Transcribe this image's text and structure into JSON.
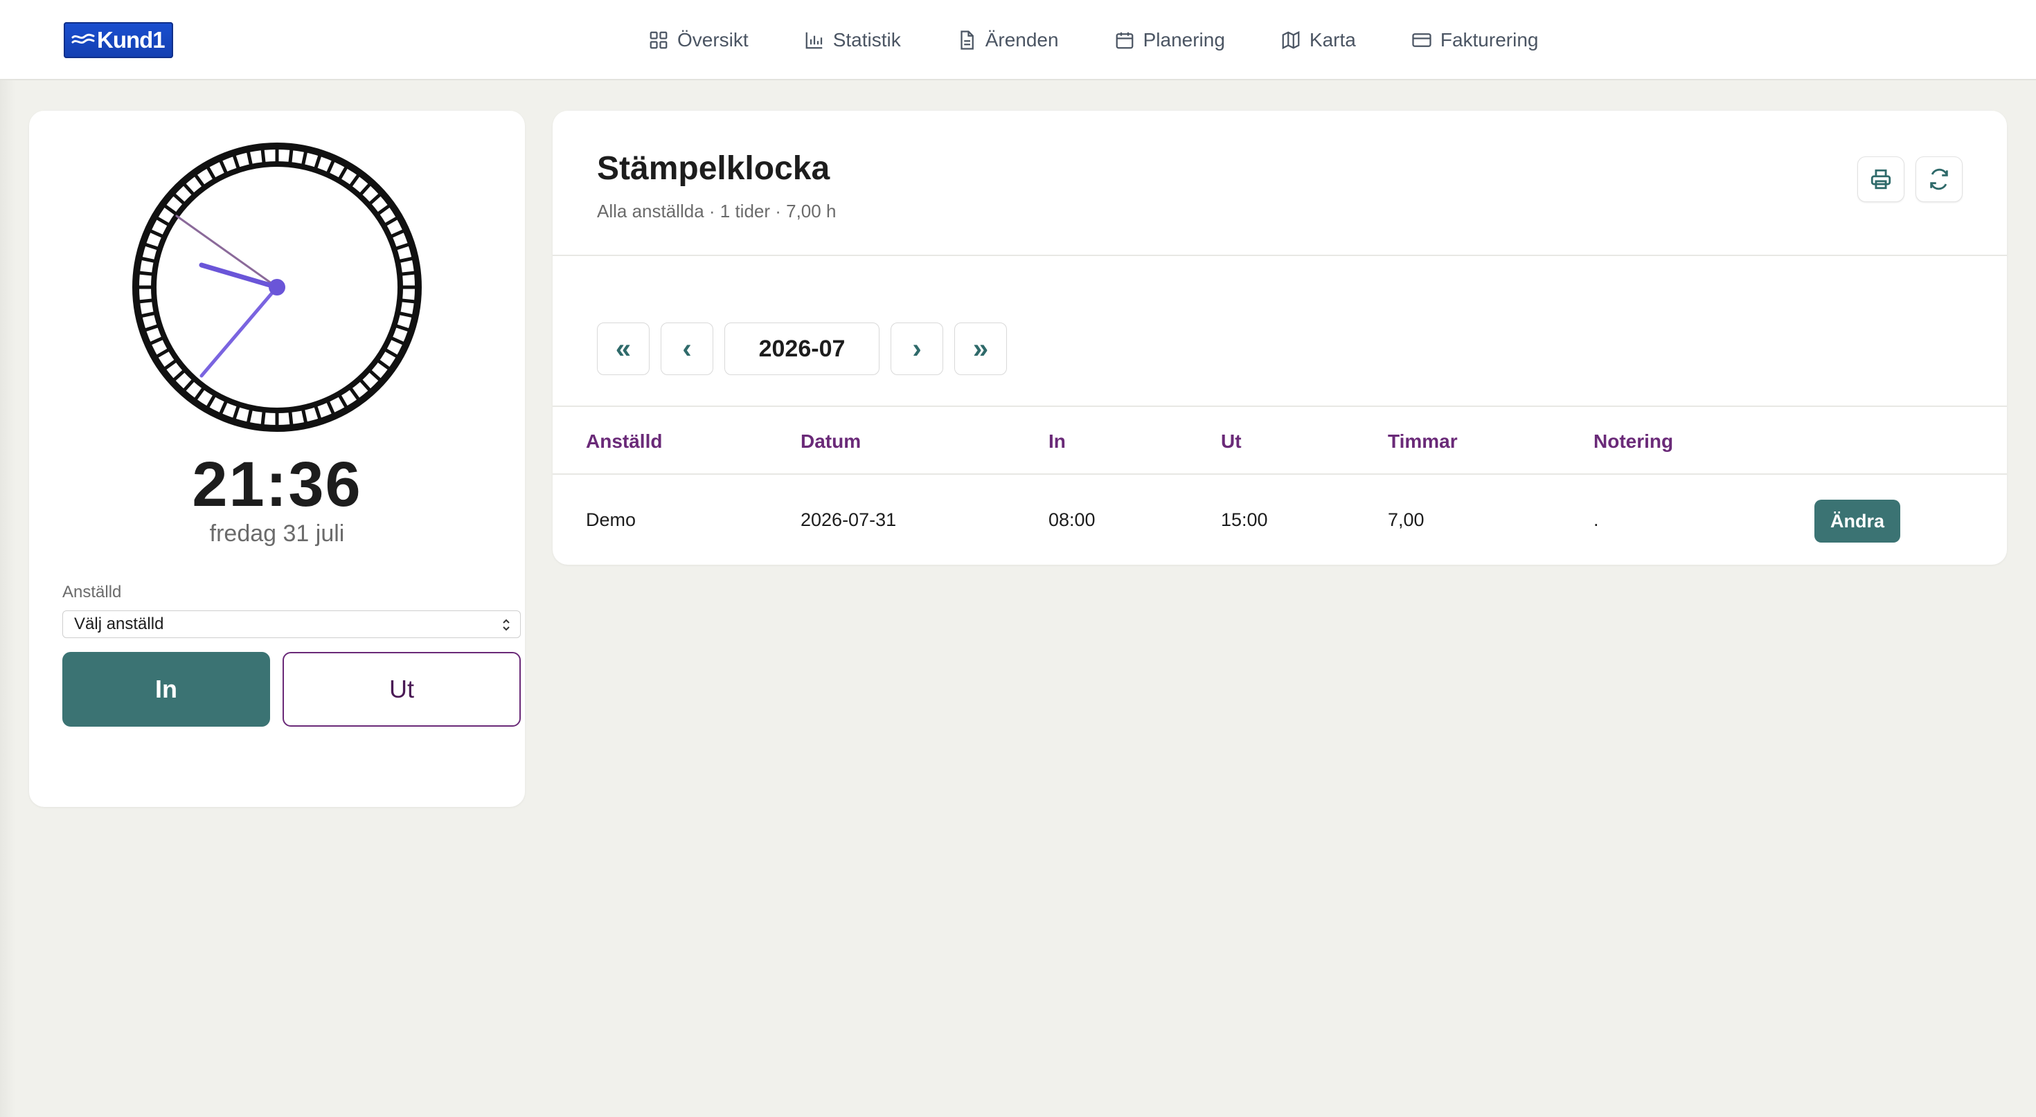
{
  "app": {
    "logo_text": "Kund1",
    "brand_color": "#1a4fd0",
    "accent_color": "#3b7373",
    "header_color": "#6a2a78"
  },
  "nav": {
    "items": [
      {
        "label": "Översikt",
        "icon": "grid-icon"
      },
      {
        "label": "Statistik",
        "icon": "bar-chart-icon"
      },
      {
        "label": "Ärenden",
        "icon": "document-icon"
      },
      {
        "label": "Planering",
        "icon": "calendar-icon"
      },
      {
        "label": "Karta",
        "icon": "map-icon"
      },
      {
        "label": "Fakturering",
        "icon": "credit-card-icon"
      }
    ]
  },
  "clock": {
    "time": "21:36",
    "date": "fredag 31 juli",
    "employee_label": "Anställd",
    "employee_select_value": "Välj anställd",
    "in_label": "In",
    "out_label": "Ut"
  },
  "main": {
    "title": "Stämpelklocka",
    "subtitle": "Alla anställda · 1 tider · 7,00 h",
    "print_icon": "printer-icon",
    "refresh_icon": "refresh-icon",
    "pager": {
      "first": "«",
      "prev": "‹",
      "month": "2026-07",
      "next": "›",
      "last": "»"
    },
    "table": {
      "headers": [
        "Anställd",
        "Datum",
        "In",
        "Ut",
        "Timmar",
        "Notering"
      ],
      "rows": [
        {
          "employee": "Demo",
          "date": "2026-07-31",
          "in": "08:00",
          "out": "15:00",
          "hours": "7,00",
          "note": ".",
          "action": "Ändra"
        }
      ]
    }
  }
}
